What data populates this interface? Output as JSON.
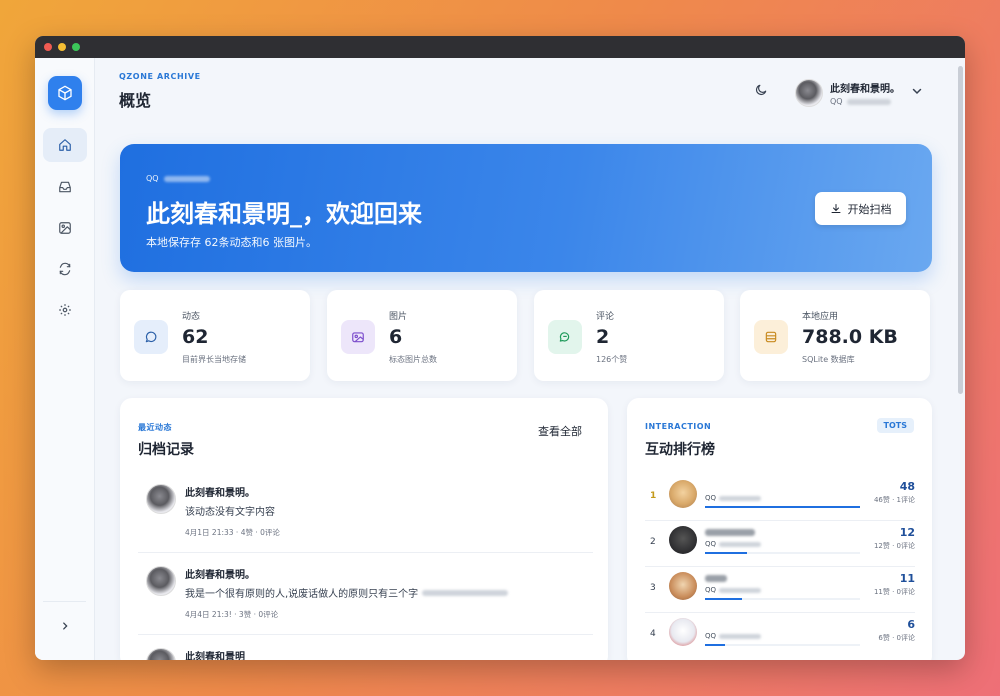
{
  "brand": "QZONE ARCHIVE",
  "page_title": "概览",
  "user": {
    "name": "此刻春和景明。",
    "qq_label": "QQ"
  },
  "hero": {
    "qq_label": "QQ",
    "title": "此刻春和景明_，欢迎回来",
    "subtitle": "本地保存存 62条动态和6 张图片。",
    "button_label": "开始扫档"
  },
  "stats": [
    {
      "label": "动态",
      "value": "62",
      "note": "目前界长当地存储",
      "icon": "message-icon",
      "color": "#e5eefb"
    },
    {
      "label": "图片",
      "value": "6",
      "note": "标态图片总数",
      "icon": "image-icon",
      "color": "#ede6fa"
    },
    {
      "label": "评论",
      "value": "2",
      "note": "126个赞",
      "icon": "chat-icon",
      "color": "#e2f5ec"
    },
    {
      "label": "本地应用",
      "value": "788.0 KB",
      "note": "SQLite 数据库",
      "icon": "database-icon",
      "color": "#fcefd9"
    }
  ],
  "archive": {
    "kicker": "最近动态",
    "title": "归档记录",
    "view_all": "查看全部",
    "posts": [
      {
        "name": "此刻春和景明。",
        "text": "该动态没有文字内容",
        "meta": "4月1日 21:33 · 4赞 · 0评论"
      },
      {
        "name": "此刻春和景明。",
        "text": "我是一个很有原则的人,说废话做人的原则只有三个字",
        "meta": "4月4日 21:3! · 3赞 · 0评论"
      },
      {
        "name": "此刻春和景明",
        "text": "",
        "meta": ""
      }
    ]
  },
  "ranking": {
    "kicker": "INTERACTION",
    "title": "互动排行榜",
    "badge": "TOTS",
    "rows": [
      {
        "rank": "1",
        "qq_label": "QQ",
        "score": "48",
        "detail": "46赞 · 1评论",
        "fill": 1.0,
        "avatar_color": "#d9a96a"
      },
      {
        "rank": "2",
        "qq_label": "QQ",
        "score": "12",
        "detail": "12赞 · 0评论",
        "fill": 0.27,
        "avatar_color": "#2b2b2e"
      },
      {
        "rank": "3",
        "qq_label": "QQ",
        "score": "11",
        "detail": "11赞 · 0评论",
        "fill": 0.24,
        "avatar_color": "#c98c5a"
      },
      {
        "rank": "4",
        "qq_label": "QQ",
        "score": "6",
        "detail": "6赞 · 0评论",
        "fill": 0.13,
        "avatar_color": "#e8e9f0"
      }
    ]
  },
  "colors": {
    "accent": "#2f80ed",
    "hero_start": "#1f6fe0",
    "hero_end": "#6aa8f0"
  }
}
